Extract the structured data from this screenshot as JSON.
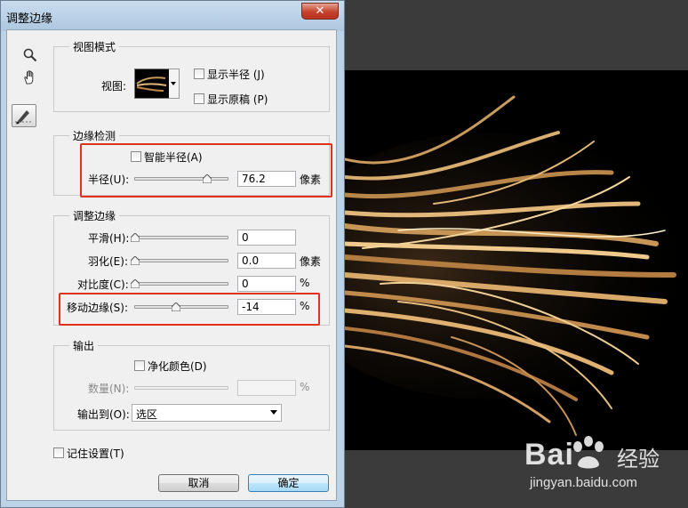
{
  "dialog": {
    "title": "调整边缘",
    "close_glyph": "✕"
  },
  "view_mode": {
    "group_title": "视图模式",
    "view_label": "视图:",
    "show_radius_label": "显示半径 (J)",
    "show_original_label": "显示原稿 (P)"
  },
  "edge_detection": {
    "group_title": "边缘检测",
    "smart_radius_label": "智能半径(A)",
    "radius_label": "半径(U):",
    "radius_value": "76.2",
    "radius_unit": "像素",
    "radius_slider": 0.85
  },
  "adjust_edge": {
    "group_title": "调整边缘",
    "smooth_label": "平滑(H):",
    "smooth_value": "0",
    "feather_label": "羽化(E):",
    "feather_value": "0.0",
    "feather_unit": "像素",
    "contrast_label": "对比度(C):",
    "contrast_value": "0",
    "contrast_unit": "%",
    "shift_edge_label": "移动边缘(S):",
    "shift_edge_value": "-14",
    "shift_edge_unit": "%",
    "shift_edge_slider": 0.43
  },
  "output": {
    "group_title": "输出",
    "decontaminate_label": "净化颜色(D)",
    "amount_label": "数量(N):",
    "amount_value": "",
    "amount_unit": "%",
    "output_to_label": "输出到(O):",
    "output_to_value": "选区"
  },
  "remember_settings_label": "记住设置(T)",
  "buttons": {
    "cancel": "取消",
    "ok": "确定"
  },
  "watermark": {
    "logo_text": "Bai",
    "brand_text": "经验",
    "url_text": "jingyan.baidu.com"
  }
}
